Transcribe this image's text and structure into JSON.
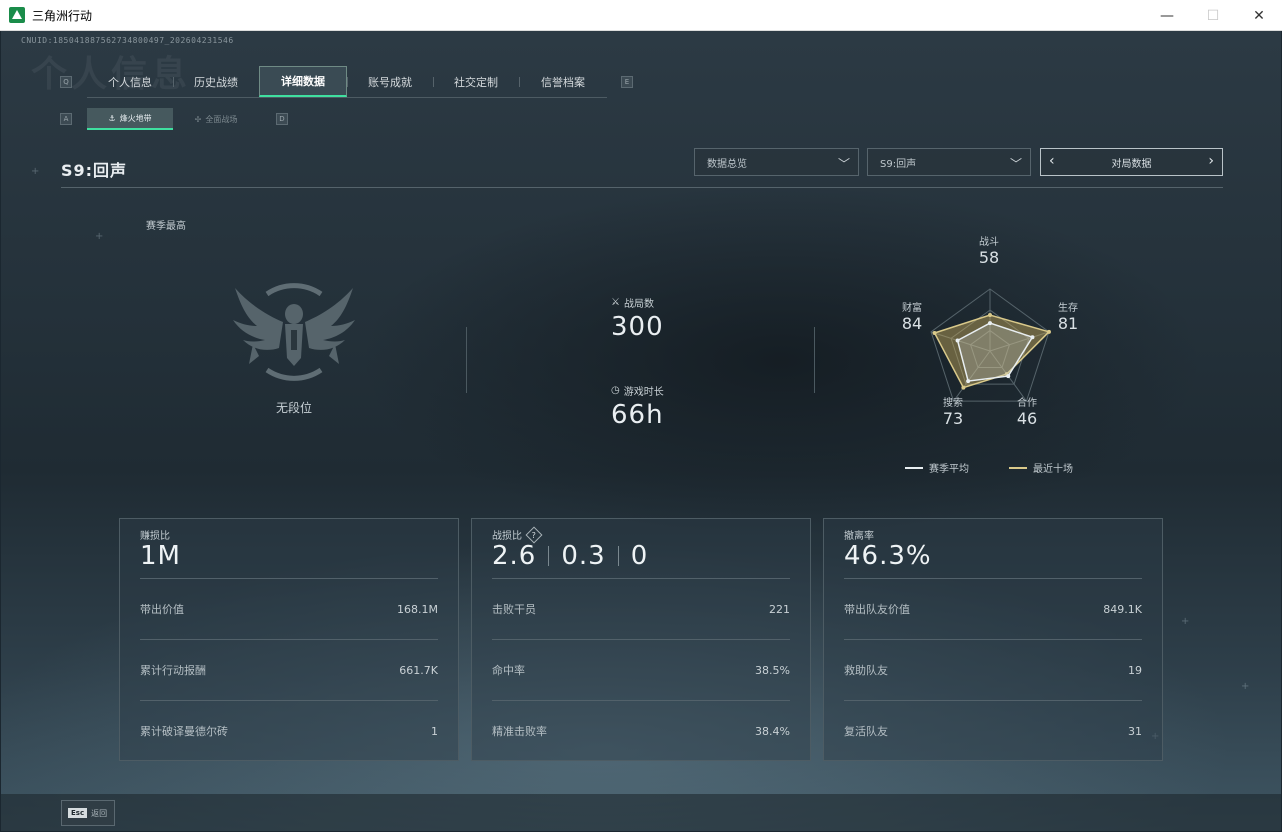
{
  "window": {
    "title": "三角洲行动",
    "minimize": "—",
    "maximize": "☐",
    "close": "✕"
  },
  "uid": "CNUID:185041887562734800497_202604231546",
  "ghost_title": "个人信息",
  "key_hints": {
    "tab_left": "Q",
    "tab_right": "E",
    "sub_left": "A",
    "sub_right": "D"
  },
  "tabs": [
    {
      "label": "个人信息"
    },
    {
      "label": "历史战绩"
    },
    {
      "label": "详细数据"
    },
    {
      "label": "账号成就"
    },
    {
      "label": "社交定制"
    },
    {
      "label": "信誉档案"
    }
  ],
  "active_tab": "详细数据",
  "subtabs": [
    {
      "label": "烽火地带",
      "icon": "fire-zone-icon"
    },
    {
      "label": "全面战场",
      "icon": "battlefield-icon"
    }
  ],
  "season_title": "S9:回声",
  "filters": {
    "overview": "数据总览",
    "season": "S9:回声",
    "pager": "对局数据"
  },
  "season_high": {
    "label": "赛季最高",
    "rank": "无段位"
  },
  "summary": {
    "matches_label": "战局数",
    "matches_value": "300",
    "playtime_label": "游戏时长",
    "playtime_value": "66h"
  },
  "radar": {
    "axes": [
      {
        "name": "战斗",
        "value": "58"
      },
      {
        "name": "生存",
        "value": "81"
      },
      {
        "name": "合作",
        "value": "46"
      },
      {
        "name": "搜索",
        "value": "73"
      },
      {
        "name": "财富",
        "value": "84"
      }
    ],
    "season_avg": [
      0.45,
      0.72,
      0.5,
      0.6,
      0.55
    ],
    "recent_ten": [
      0.58,
      1.0,
      0.46,
      0.73,
      0.94
    ]
  },
  "legend": {
    "season_avg": "赛季平均",
    "recent_ten": "最近十场",
    "season_avg_color": "#e8eef1",
    "recent_ten_color": "#d9c98a"
  },
  "panels": {
    "profit": {
      "title": "赚损比",
      "big": "1M",
      "rows": [
        {
          "k": "带出价值",
          "v": "168.1M"
        },
        {
          "k": "累计行动报酬",
          "v": "661.7K"
        },
        {
          "k": "累计破译曼德尔砖",
          "v": "1"
        }
      ]
    },
    "kd": {
      "title": "战损比",
      "big1": "2.6",
      "big2": "0.3",
      "big3": "0",
      "rows": [
        {
          "k": "击败干员",
          "v": "221"
        },
        {
          "k": "命中率",
          "v": "38.5%"
        },
        {
          "k": "精准击败率",
          "v": "38.4%"
        }
      ]
    },
    "extract": {
      "title": "撤离率",
      "big": "46.3%",
      "rows": [
        {
          "k": "带出队友价值",
          "v": "849.1K"
        },
        {
          "k": "救助队友",
          "v": "19"
        },
        {
          "k": "复活队友",
          "v": "31"
        }
      ]
    }
  },
  "esc": {
    "key": "Esc",
    "label": "返回"
  }
}
